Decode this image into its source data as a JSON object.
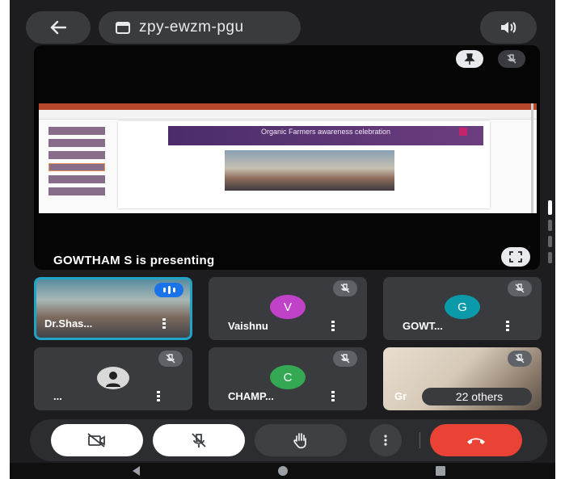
{
  "meeting": {
    "code": "zpy-ewzm-pgu"
  },
  "presentation": {
    "presenter_label": "GOWTHAM S is presenting",
    "slide_title": "Organic Farmers awareness celebration"
  },
  "participants": [
    {
      "name": "Dr.Shas...",
      "avatar_letter": "",
      "avatar_color": ""
    },
    {
      "name": "Vaishnu",
      "avatar_letter": "V",
      "avatar_color": "#c042c8"
    },
    {
      "name": "GOWT...",
      "avatar_letter": "G",
      "avatar_color": "#0b9aa9"
    },
    {
      "name": "...",
      "avatar_letter": "",
      "avatar_color": ""
    },
    {
      "name": "CHAMP...",
      "avatar_letter": "C",
      "avatar_color": "#34a853"
    },
    {
      "name": "Gr",
      "avatar_letter": "",
      "avatar_color": ""
    }
  ],
  "others_label": "22 others",
  "colors": {
    "end_call": "#ea4335",
    "speaking": "#1a73e8",
    "active_border": "#1fa3c7"
  },
  "icons": [
    "back-arrow-icon",
    "calendar-icon",
    "speaker-icon",
    "pin-icon",
    "mic-off-icon",
    "fullscreen-icon",
    "camera-off-icon",
    "raise-hand-icon",
    "more-vert-icon",
    "end-call-icon"
  ]
}
